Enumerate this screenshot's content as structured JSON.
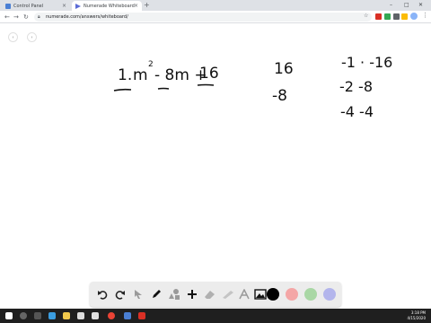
{
  "browser": {
    "tabs": [
      {
        "title": "Control Panel"
      },
      {
        "title": "Numerade Whiteboard"
      }
    ],
    "new_tab": "+",
    "window_controls": [
      "–",
      "□",
      "✕"
    ],
    "url": "numerade.com/answers/whiteboard/"
  },
  "board": {
    "prev": "‹",
    "next": "›",
    "problem_number": "1.",
    "expr": {
      "m": "m",
      "exp": "2",
      "middle": "- 8m +",
      "const": "16"
    },
    "product": "16",
    "sum": "-8",
    "factor_pairs": [
      "-1 · -16",
      "-2  -8",
      "-4  -4"
    ]
  },
  "drawbar": {
    "colors": [
      "#000000",
      "#f4a6a6",
      "#a9d7a5",
      "#b3b5ec"
    ]
  },
  "taskbar": {
    "time": "3:18 PM",
    "date": "4/15/2020"
  }
}
